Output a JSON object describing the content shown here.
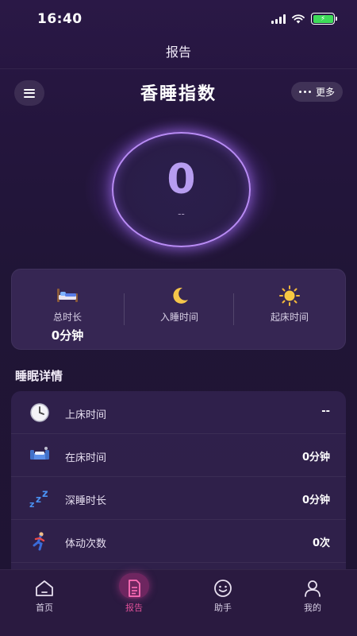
{
  "status_bar": {
    "time": "16:40"
  },
  "nav": {
    "title": "报告"
  },
  "header": {
    "title": "香睡指数",
    "more_label": "更多"
  },
  "score": {
    "value": "0",
    "sub": "--"
  },
  "stats": [
    {
      "icon": "bed-icon",
      "label": "总时长",
      "value": "0分钟"
    },
    {
      "icon": "moon-icon",
      "label": "入睡时间",
      "value": ""
    },
    {
      "icon": "sun-icon",
      "label": "起床时间",
      "value": ""
    }
  ],
  "section": {
    "title": "睡眠详情"
  },
  "details": [
    {
      "icon": "clock-icon",
      "label": "上床时间",
      "value": "--"
    },
    {
      "icon": "sofa-bed-icon",
      "label": "在床时间",
      "value": "0分钟"
    },
    {
      "icon": "zzz-icon",
      "label": "深睡时长",
      "value": "0分钟"
    },
    {
      "icon": "running-person-icon",
      "label": "体动次数",
      "value": "0次"
    }
  ],
  "tabs": [
    {
      "icon": "home-icon",
      "label": "首页",
      "active": false
    },
    {
      "icon": "report-document-icon",
      "label": "报告",
      "active": true
    },
    {
      "icon": "smiley-assistant-icon",
      "label": "助手",
      "active": false
    },
    {
      "icon": "user-icon",
      "label": "我的",
      "active": false
    }
  ],
  "colors": {
    "accent": "#e0509a",
    "ring": "#b98cf5",
    "score": "#b79df0"
  }
}
